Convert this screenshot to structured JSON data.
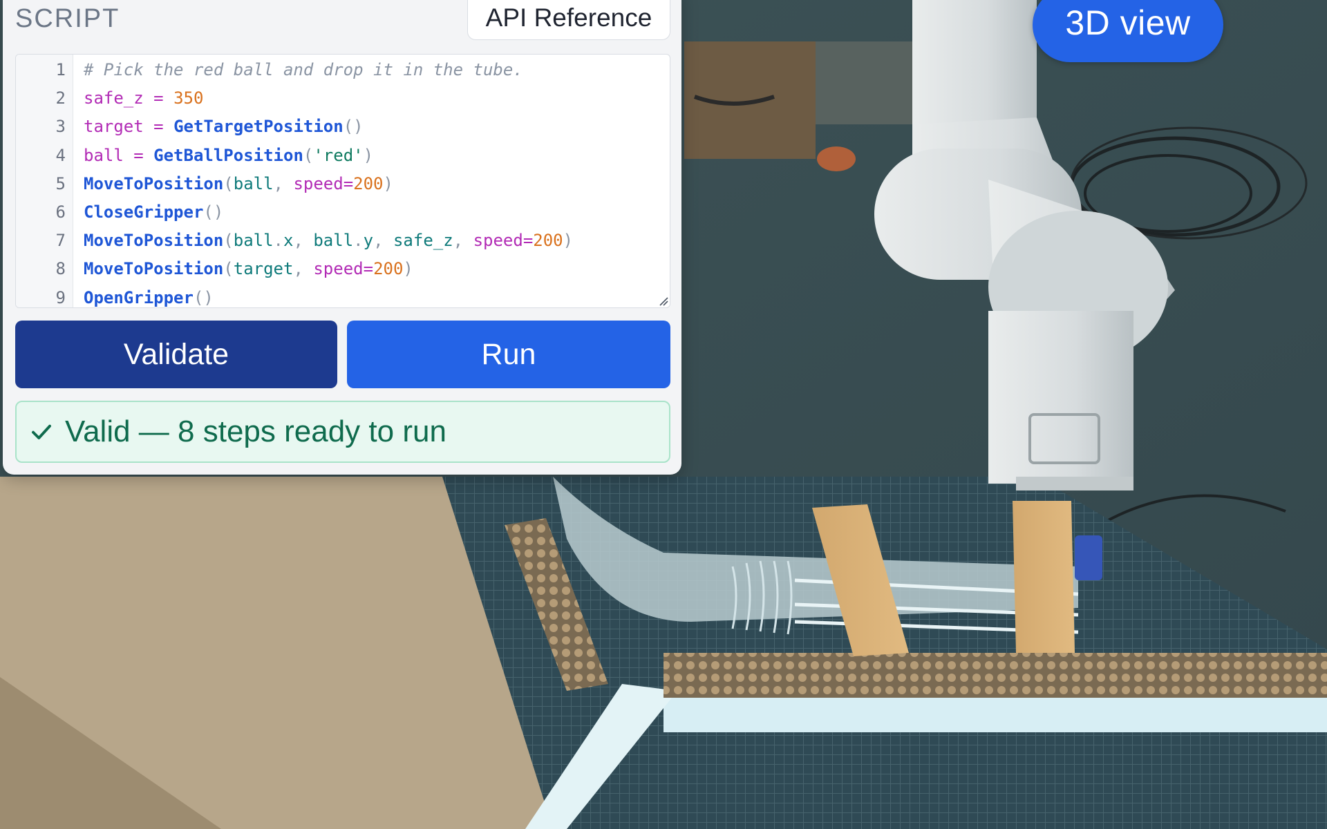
{
  "panel": {
    "title": "SCRIPT",
    "api_reference_label": "API Reference"
  },
  "editor": {
    "lines": [
      {
        "no": "1",
        "text": "# Pick the red ball and drop it in the tube."
      },
      {
        "no": "2",
        "text": "safe_z = 350"
      },
      {
        "no": "3",
        "text": "target = GetTargetPosition()"
      },
      {
        "no": "4",
        "text": "ball = GetBallPosition('red')"
      },
      {
        "no": "5",
        "text": "MoveToPosition(ball, speed=200)"
      },
      {
        "no": "6",
        "text": "CloseGripper()"
      },
      {
        "no": "7",
        "text": "MoveToPosition(ball.x, ball.y, safe_z, speed=200)"
      },
      {
        "no": "8",
        "text": "MoveToPosition(target, speed=200)"
      },
      {
        "no": "9",
        "text": "OpenGripper()"
      }
    ]
  },
  "actions": {
    "validate_label": "Validate",
    "run_label": "Run"
  },
  "status": {
    "text": "Valid — 8 steps ready to run",
    "state": "valid",
    "icon": "check-icon",
    "color": "#0f6b4d"
  },
  "view_toggle": {
    "label": "3D view"
  },
  "colors": {
    "accent": "#2463e6",
    "validate": "#1d3a8f",
    "success_bg": "#e8f8f1"
  }
}
